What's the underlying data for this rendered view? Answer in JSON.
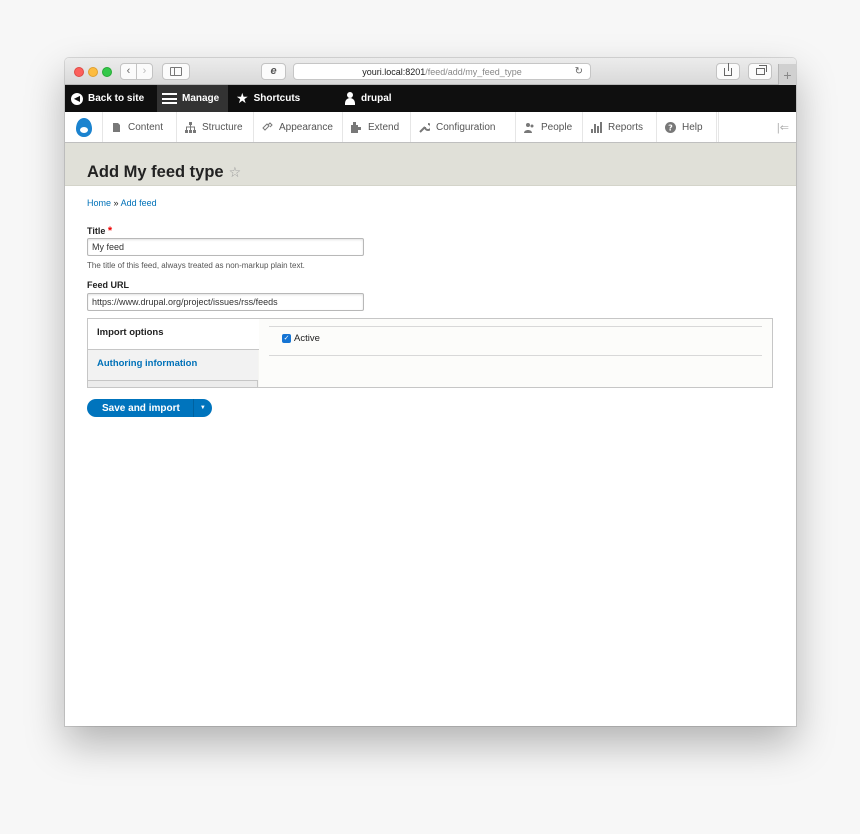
{
  "browser": {
    "url_host": "youri.local:8201",
    "url_path": "/feed/add/my_feed_type",
    "back_icon": "‹",
    "forward_icon": "›",
    "reload_icon": "↻",
    "new_tab_icon": "+"
  },
  "toolbar": {
    "back_to_site": "Back to site",
    "manage": "Manage",
    "shortcuts": "Shortcuts",
    "user": "drupal"
  },
  "admin_menu": {
    "items": [
      {
        "label": "Content",
        "icon": "content-icon"
      },
      {
        "label": "Structure",
        "icon": "structure-icon"
      },
      {
        "label": "Appearance",
        "icon": "appearance-icon"
      },
      {
        "label": "Extend",
        "icon": "extend-icon"
      },
      {
        "label": "Configuration",
        "icon": "configuration-icon"
      },
      {
        "label": "People",
        "icon": "people-icon"
      },
      {
        "label": "Reports",
        "icon": "reports-icon"
      },
      {
        "label": "Help",
        "icon": "help-icon"
      }
    ],
    "orientation_toggle": "|⇐"
  },
  "page": {
    "title": "Add My feed type",
    "star": "☆"
  },
  "breadcrumb": {
    "home": "Home",
    "separator": "»",
    "current": "Add feed"
  },
  "form": {
    "title_label": "Title",
    "required_marker": "*",
    "title_value": "My feed",
    "title_description": "The title of this feed, always treated as non-markup plain text.",
    "feed_url_label": "Feed URL",
    "feed_url_value": "https://www.drupal.org/project/issues/rss/feeds"
  },
  "vertical_tabs": {
    "tabs": [
      "Import options",
      "Authoring information"
    ],
    "active_label": "Active",
    "active_checked": true
  },
  "actions": {
    "save_and_import": "Save and import",
    "dropdown_icon": "▼"
  },
  "colors": {
    "link": "#0071b8",
    "button": "#0074bd",
    "toolbar": "#0f0f0f",
    "header": "#e0e0d8"
  }
}
